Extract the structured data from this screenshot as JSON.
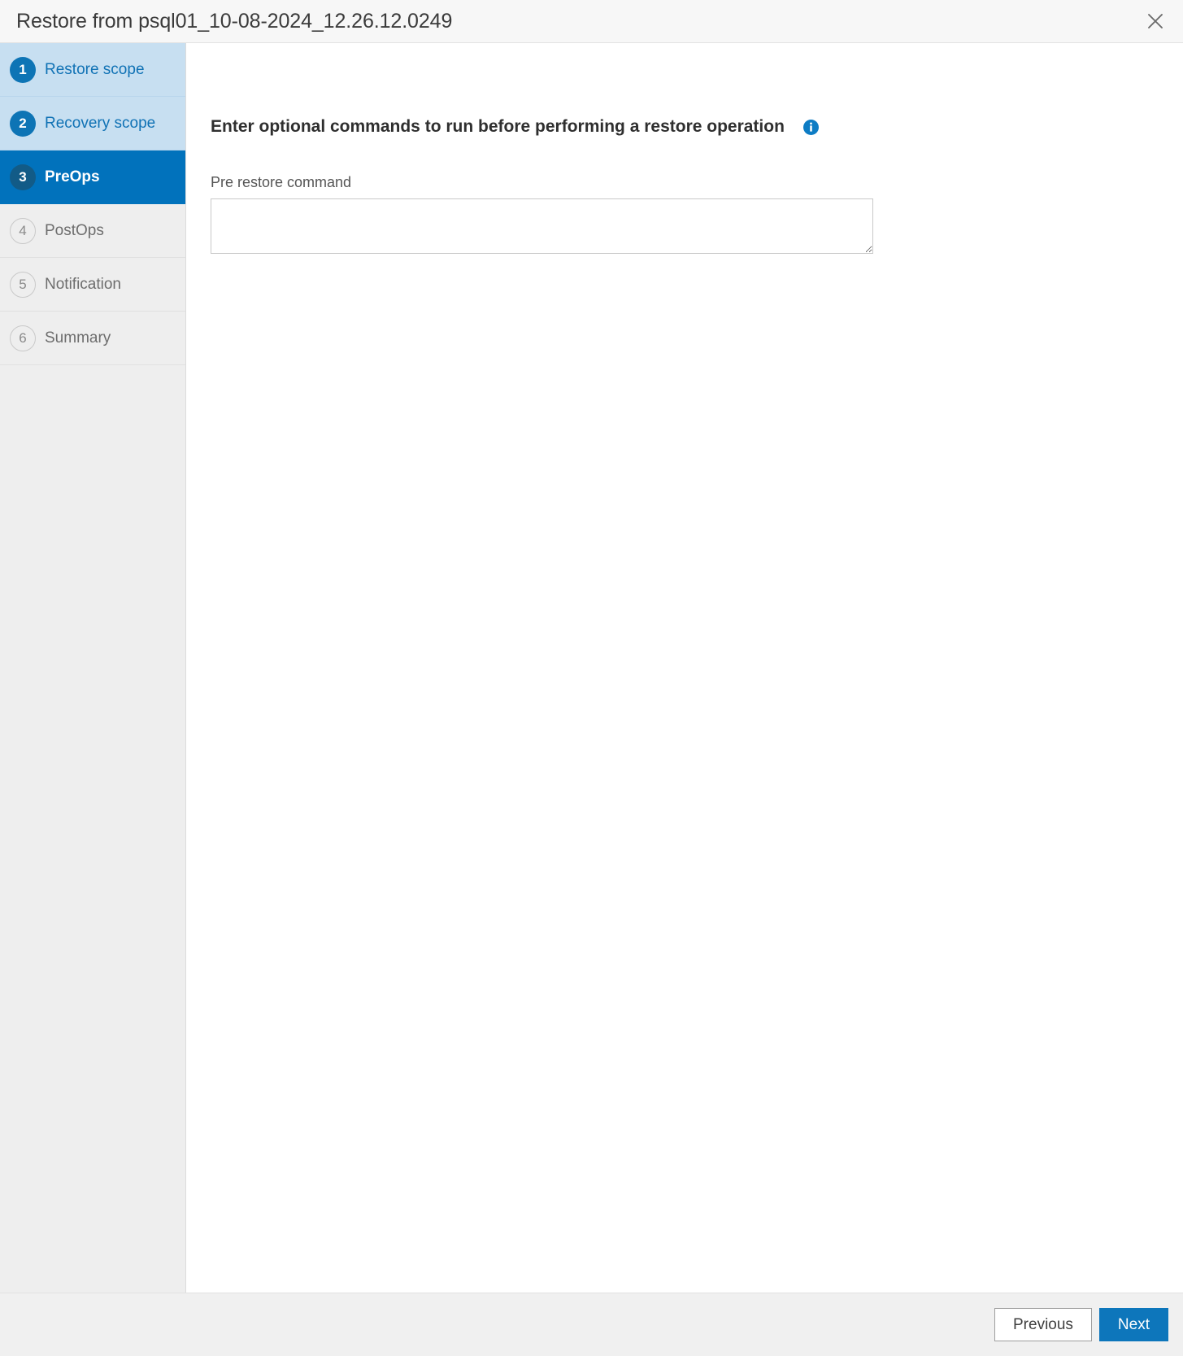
{
  "dialog": {
    "title": "Restore from psql01_10-08-2024_12.26.12.0249",
    "close_icon": "close-icon"
  },
  "sidebar": {
    "items": [
      {
        "number": "1",
        "label": "Restore scope",
        "state": "done"
      },
      {
        "number": "2",
        "label": "Recovery scope",
        "state": "done"
      },
      {
        "number": "3",
        "label": "PreOps",
        "state": "active"
      },
      {
        "number": "4",
        "label": "PostOps",
        "state": "pending"
      },
      {
        "number": "5",
        "label": "Notification",
        "state": "pending"
      },
      {
        "number": "6",
        "label": "Summary",
        "state": "pending"
      }
    ]
  },
  "content": {
    "heading": "Enter optional commands to run before performing a restore operation",
    "info_icon": "info-icon",
    "pre_restore": {
      "label": "Pre restore command",
      "value": "",
      "placeholder": ""
    }
  },
  "footer": {
    "previous_label": "Previous",
    "next_label": "Next"
  },
  "colors": {
    "accent": "#0172bc",
    "accent_button": "#0d76bb",
    "step_done_bg": "#c7dff1",
    "step_done_badge": "#0d74b5",
    "step_active_badge": "#125b87",
    "step_pending_bg": "#eeeeee",
    "titlebar_bg": "#f7f7f7",
    "footer_bg": "#f0f0f0",
    "info_icon": "#0d7cc4"
  }
}
